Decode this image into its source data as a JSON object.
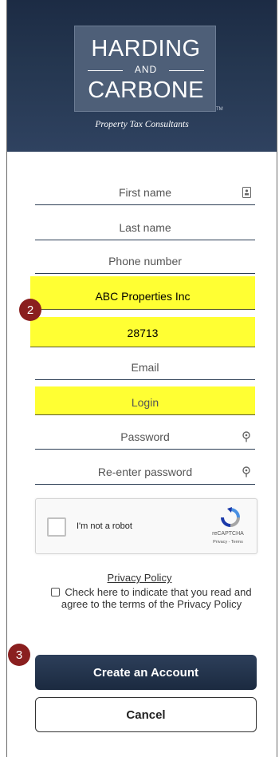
{
  "brand": {
    "name_line1": "HARDING",
    "name_and": "AND",
    "name_line2": "CARBONE",
    "trademark": "TM",
    "tagline": "Property Tax Consultants"
  },
  "form": {
    "fields": [
      {
        "label": "First name",
        "icon": "contact-card-icon"
      },
      {
        "label": "Last name"
      },
      {
        "label": "Phone number"
      },
      {
        "label": "ABC Properties Inc",
        "highlighted": true
      },
      {
        "label": "28713",
        "highlighted": true
      },
      {
        "label": "Email"
      },
      {
        "label": "Login",
        "highlighted": true
      },
      {
        "label": "Password",
        "icon": "key-icon"
      },
      {
        "label": "Re-enter password",
        "icon": "key-icon"
      }
    ],
    "highlight_color": "#ffff33"
  },
  "captcha": {
    "label": "I'm not a robot",
    "brand": "reCAPTCHA",
    "links": "Privacy - Terms"
  },
  "privacy": {
    "link_text": "Privacy Policy",
    "agree_text": "Check here to indicate that you read and agree to the terms of the Privacy Policy"
  },
  "buttons": {
    "create_label": "Create an Account",
    "cancel_label": "Cancel"
  },
  "annotations": {
    "step2": "2",
    "step3": "3",
    "badge_color": "#8a1f1f"
  }
}
